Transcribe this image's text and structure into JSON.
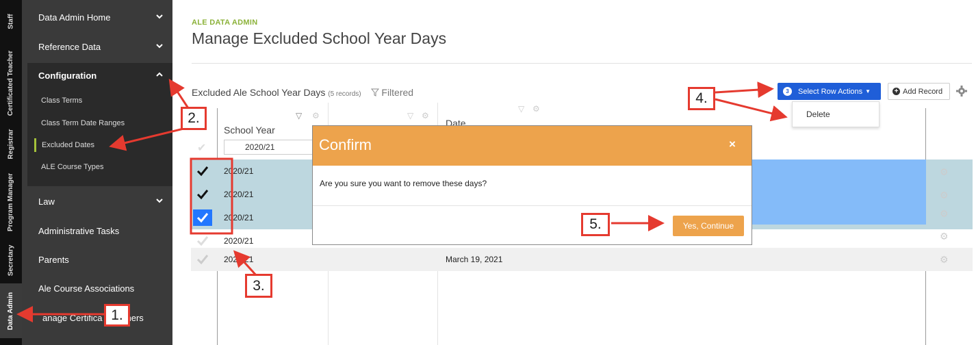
{
  "role_tabs": [
    "Staff",
    "Certificated Teacher",
    "Registrar",
    "Program Manager",
    "Secretary",
    "Data Admin"
  ],
  "sidebar": {
    "items": [
      {
        "label": "Data Admin Home",
        "chevron": "down"
      },
      {
        "label": "Reference Data",
        "chevron": "down"
      },
      {
        "label": "Configuration",
        "chevron": "up"
      },
      {
        "label": "Law",
        "chevron": "down"
      },
      {
        "label": "Administrative Tasks"
      },
      {
        "label": "Parents"
      },
      {
        "label": "Ale Course Associations"
      },
      {
        "label": "anage Certifica"
      },
      {
        "label": "chers"
      }
    ],
    "config_subitems": [
      "Class Terms",
      "Class Term Date Ranges",
      "Excluded Dates",
      "ALE Course Types"
    ]
  },
  "header": {
    "brand": "ALE DATA ADMIN",
    "title": "Manage Excluded School Year Days"
  },
  "grid": {
    "title": "Excluded Ale School Year Days",
    "record_count": "(5 records)",
    "filtered": "Filtered",
    "select_actions_label": "Select Row Actions",
    "selected_count": "3",
    "dropdown_delete": "Delete",
    "add_record_label": "Add Record",
    "col_school_year": "School Year",
    "col_date": "Date",
    "filter_value": "2020/21",
    "rows": [
      {
        "year": "2020/21",
        "date": "",
        "checked": true
      },
      {
        "year": "2020/21",
        "date": "",
        "checked": true
      },
      {
        "year": "2020/21",
        "date": "",
        "checked": true
      },
      {
        "year": "2020/21",
        "date": "",
        "checked": false
      },
      {
        "year": "2020/21",
        "date": "March 19, 2021",
        "checked": false
      }
    ]
  },
  "modal": {
    "title": "Confirm",
    "close_icon": "×",
    "message": "Are you sure you want to remove these days?",
    "confirm_label": "Yes, Continue"
  },
  "annotations": [
    "1.",
    "2.",
    "3.",
    "4.",
    "5."
  ],
  "colors": {
    "accent_orange": "#eda34c",
    "primary_blue": "#1f5ed8",
    "annotation_red": "#e53a2f",
    "brand_green": "#8cb23a"
  }
}
